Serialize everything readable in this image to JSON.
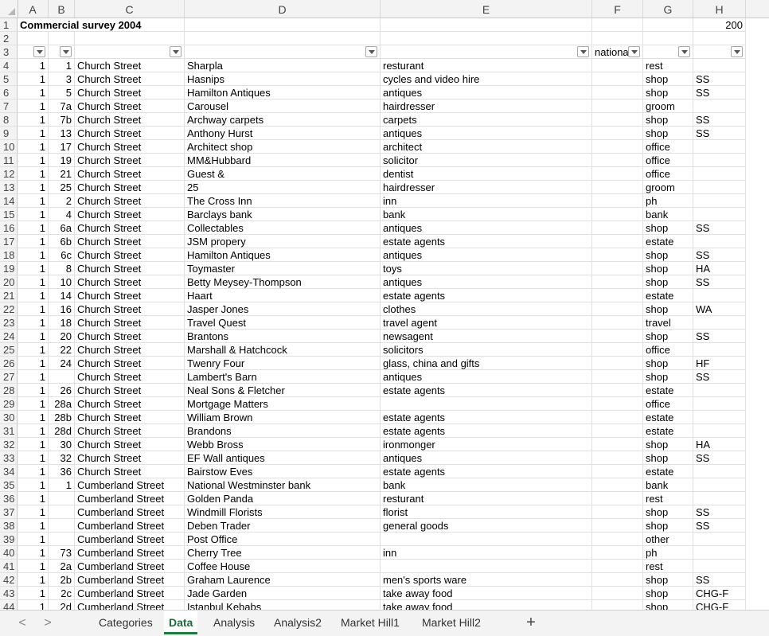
{
  "columns": [
    "A",
    "B",
    "C",
    "D",
    "E",
    "F",
    "G",
    "H"
  ],
  "title": "Commercial survey 2004",
  "year_value": "200",
  "header_row3": {
    "F": "national"
  },
  "rows": [
    {
      "n": "4",
      "A": "1",
      "B": "1",
      "C": "Church Street",
      "D": "Sharpla",
      "E": "resturant",
      "G": "rest",
      "H": ""
    },
    {
      "n": "5",
      "A": "1",
      "B": "3",
      "C": "Church Street",
      "D": "Hasnips",
      "E": "cycles and video hire",
      "G": "shop",
      "H": "SS"
    },
    {
      "n": "6",
      "A": "1",
      "B": "5",
      "C": "Church Street",
      "D": "Hamilton Antiques",
      "E": "antiques",
      "G": "shop",
      "H": "SS"
    },
    {
      "n": "7",
      "A": "1",
      "B": "7a",
      "C": "Church Street",
      "D": "Carousel",
      "E": "hairdresser",
      "G": "groom",
      "H": ""
    },
    {
      "n": "8",
      "A": "1",
      "B": "7b",
      "C": "Church Street",
      "D": "Archway carpets",
      "E": "carpets",
      "G": "shop",
      "H": "SS"
    },
    {
      "n": "9",
      "A": "1",
      "B": "13",
      "C": "Church Street",
      "D": "Anthony Hurst",
      "E": "antiques",
      "G": "shop",
      "H": "SS"
    },
    {
      "n": "10",
      "A": "1",
      "B": "17",
      "C": "Church Street",
      "D": "Architect shop",
      "E": "architect",
      "G": "office",
      "H": ""
    },
    {
      "n": "11",
      "A": "1",
      "B": "19",
      "C": "Church Street",
      "D": "MM&Hubbard",
      "E": "solicitor",
      "G": "office",
      "H": ""
    },
    {
      "n": "12",
      "A": "1",
      "B": "21",
      "C": "Church Street",
      "D": "Guest &",
      "E": "dentist",
      "G": "office",
      "H": ""
    },
    {
      "n": "13",
      "A": "1",
      "B": "25",
      "C": "Church Street",
      "D": "25",
      "E": "hairdresser",
      "G": "groom",
      "H": ""
    },
    {
      "n": "14",
      "A": "1",
      "B": "2",
      "C": "Church Street",
      "D": "The Cross Inn",
      "E": "inn",
      "G": "ph",
      "H": ""
    },
    {
      "n": "15",
      "A": "1",
      "B": "4",
      "C": "Church Street",
      "D": "Barclays bank",
      "E": "bank",
      "G": "bank",
      "H": ""
    },
    {
      "n": "16",
      "A": "1",
      "B": "6a",
      "C": "Church Street",
      "D": "Collectables",
      "E": "antiques",
      "G": "shop",
      "H": "SS"
    },
    {
      "n": "17",
      "A": "1",
      "B": "6b",
      "C": "Church Street",
      "D": "JSM propery",
      "E": "estate agents",
      "G": "estate",
      "H": ""
    },
    {
      "n": "18",
      "A": "1",
      "B": "6c",
      "C": "Church Street",
      "D": "Hamilton Antiques",
      "E": "antiques",
      "G": "shop",
      "H": "SS"
    },
    {
      "n": "19",
      "A": "1",
      "B": "8",
      "C": "Church Street",
      "D": "Toymaster",
      "E": "toys",
      "G": "shop",
      "H": "HA"
    },
    {
      "n": "20",
      "A": "1",
      "B": "10",
      "C": "Church Street",
      "D": "Betty Meysey-Thompson",
      "E": "antiques",
      "G": "shop",
      "H": "SS"
    },
    {
      "n": "21",
      "A": "1",
      "B": "14",
      "C": "Church Street",
      "D": "Haart",
      "E": "estate agents",
      "G": "estate",
      "H": ""
    },
    {
      "n": "22",
      "A": "1",
      "B": "16",
      "C": "Church Street",
      "D": "Jasper Jones",
      "E": "clothes",
      "G": "shop",
      "H": "WA"
    },
    {
      "n": "23",
      "A": "1",
      "B": "18",
      "C": "Church Street",
      "D": "Travel Quest",
      "E": "travel agent",
      "G": "travel",
      "H": ""
    },
    {
      "n": "24",
      "A": "1",
      "B": "20",
      "C": "Church Street",
      "D": "Brantons",
      "E": "newsagent",
      "G": "shop",
      "H": "SS"
    },
    {
      "n": "25",
      "A": "1",
      "B": "22",
      "C": "Church Street",
      "D": "Marshall & Hatchcock",
      "E": "solicitors",
      "G": "office",
      "H": ""
    },
    {
      "n": "26",
      "A": "1",
      "B": "24",
      "C": "Church Street",
      "D": "Twenry Four",
      "E": "glass, china and gifts",
      "G": "shop",
      "H": "HF"
    },
    {
      "n": "27",
      "A": "1",
      "B": "",
      "C": "Church Street",
      "D": "Lambert's Barn",
      "E": "antiques",
      "G": "shop",
      "H": "SS"
    },
    {
      "n": "28",
      "A": "1",
      "B": "26",
      "C": "Church Street",
      "D": "Neal Sons & Fletcher",
      "E": "estate agents",
      "G": "estate",
      "H": ""
    },
    {
      "n": "29",
      "A": "1",
      "B": "28a",
      "C": "Church Street",
      "D": "Mortgage Matters",
      "E": "",
      "G": "office",
      "H": ""
    },
    {
      "n": "30",
      "A": "1",
      "B": "28b",
      "C": "Church Street",
      "D": "William Brown",
      "E": "estate agents",
      "G": "estate",
      "H": ""
    },
    {
      "n": "31",
      "A": "1",
      "B": "28d",
      "C": "Church Street",
      "D": "Brandons",
      "E": "estate agents",
      "G": "estate",
      "H": ""
    },
    {
      "n": "32",
      "A": "1",
      "B": "30",
      "C": "Church Street",
      "D": "Webb Bross",
      "E": "ironmonger",
      "G": "shop",
      "H": "HA"
    },
    {
      "n": "33",
      "A": "1",
      "B": "32",
      "C": "Church Street",
      "D": "EF Wall antiques",
      "E": "antiques",
      "G": "shop",
      "H": "SS"
    },
    {
      "n": "34",
      "A": "1",
      "B": "36",
      "C": "Church Street",
      "D": "Bairstow Eves",
      "E": "estate agents",
      "G": "estate",
      "H": ""
    },
    {
      "n": "35",
      "A": "1",
      "B": "1",
      "C": "Cumberland Street",
      "D": "National Westminster bank",
      "E": "bank",
      "G": "bank",
      "H": ""
    },
    {
      "n": "36",
      "A": "1",
      "B": "",
      "C": "Cumberland Street",
      "D": "Golden Panda",
      "E": "resturant",
      "G": "rest",
      "H": ""
    },
    {
      "n": "37",
      "A": "1",
      "B": "",
      "C": "Cumberland Street",
      "D": "Windmill Florists",
      "E": "florist",
      "G": "shop",
      "H": "SS"
    },
    {
      "n": "38",
      "A": "1",
      "B": "",
      "C": "Cumberland Street",
      "D": "Deben Trader",
      "E": "general goods",
      "G": "shop",
      "H": "SS"
    },
    {
      "n": "39",
      "A": "1",
      "B": "",
      "C": "Cumberland Street",
      "D": "Post Office",
      "E": "",
      "G": "other",
      "H": ""
    },
    {
      "n": "40",
      "A": "1",
      "B": "73",
      "C": "Cumberland Street",
      "D": "Cherry Tree",
      "E": "inn",
      "G": "ph",
      "H": ""
    },
    {
      "n": "41",
      "A": "1",
      "B": "2a",
      "C": "Cumberland Street",
      "D": "Coffee House",
      "E": "",
      "G": "rest",
      "H": ""
    },
    {
      "n": "42",
      "A": "1",
      "B": "2b",
      "C": "Cumberland Street",
      "D": "Graham Laurence",
      "E": "men's sports ware",
      "G": "shop",
      "H": "SS"
    },
    {
      "n": "43",
      "A": "1",
      "B": "2c",
      "C": "Cumberland Street",
      "D": "Jade Garden",
      "E": "take away food",
      "G": "shop",
      "H": "CHG-F"
    },
    {
      "n": "44",
      "A": "1",
      "B": "2d",
      "C": "Cumberland Street",
      "D": "Istanbul Kebabs",
      "E": "take away food",
      "G": "shop",
      "H": "CHG-F"
    }
  ],
  "tabs": [
    "Categories",
    "Data",
    "Analysis",
    "Analysis2",
    "Market Hill1",
    "Market Hill2"
  ],
  "active_tab": "Data",
  "nav": {
    "prev": "<",
    "next": ">",
    "add": "+"
  }
}
